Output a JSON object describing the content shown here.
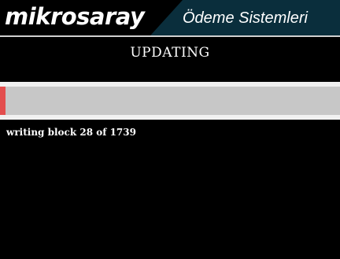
{
  "header": {
    "brand": "mikrosaray",
    "subtitle": "Ödeme Sistemleri"
  },
  "screen": {
    "title": "UPDATING",
    "status": "writing block 28 of 1739"
  },
  "progress": {
    "current_block": 28,
    "total_blocks": 1739,
    "fraction": 0.016
  },
  "colors": {
    "header_bg": "#0a2e3c",
    "progress_fill": "#e34e4e",
    "progress_track": "#c7c7c7"
  }
}
